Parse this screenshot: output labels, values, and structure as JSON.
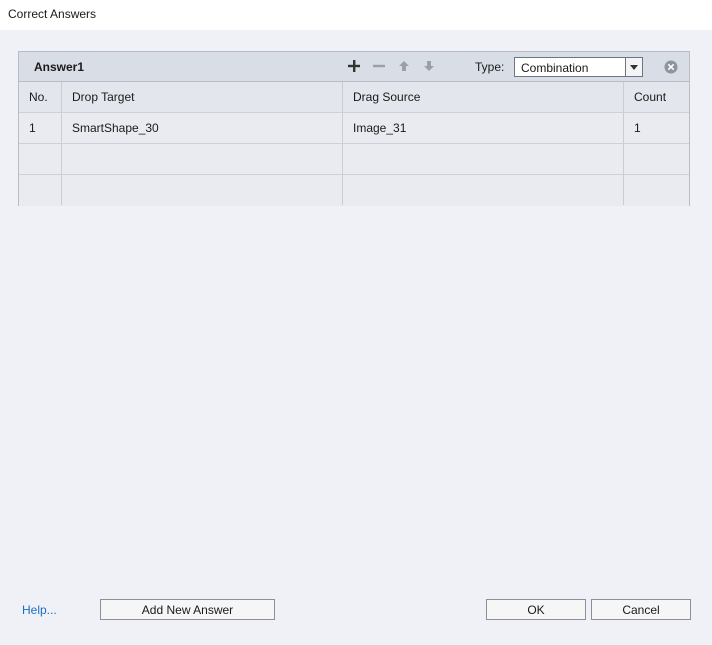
{
  "window": {
    "title": "Correct Answers"
  },
  "answer_panel": {
    "title": "Answer1",
    "toolbar": {
      "add_icon": "plus-icon",
      "remove_icon": "minus-icon",
      "move_up_icon": "arrow-up-icon",
      "move_down_icon": "arrow-down-icon"
    },
    "type_label": "Type:",
    "type_value": "Combination",
    "close_icon": "close-circle-icon"
  },
  "table": {
    "headers": [
      "No.",
      "Drop Target",
      "Drag Source",
      "Count"
    ],
    "rows": [
      [
        "1",
        "SmartShape_30",
        "Image_31",
        "1"
      ],
      [
        "",
        "",
        "",
        ""
      ],
      [
        "",
        "",
        "",
        ""
      ]
    ]
  },
  "footer": {
    "help_link": "Help...",
    "add_new_answer": "Add New Answer",
    "ok": "OK",
    "cancel": "Cancel"
  },
  "colors": {
    "background": "#f0f1f6",
    "panel_header": "#d9dde6",
    "link": "#1a6fbf"
  }
}
